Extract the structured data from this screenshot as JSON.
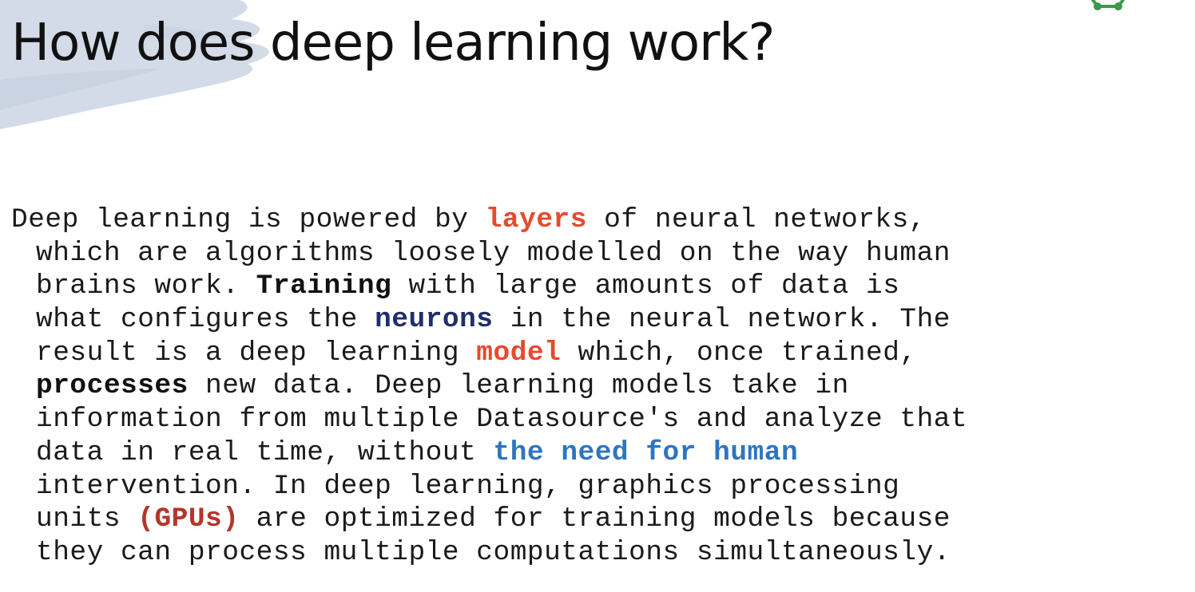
{
  "slide": {
    "title": "How does deep learning work?",
    "lines": [
      [
        {
          "text": "Deep learning is powered by "
        },
        {
          "text": "layers",
          "style": "orange"
        },
        {
          "text": " of neural networks,"
        }
      ],
      [
        {
          "text": "which are algorithms loosely modelled on the way human"
        }
      ],
      [
        {
          "text": "brains work. "
        },
        {
          "text": "Training",
          "style": "black"
        },
        {
          "text": " with large amounts of data is"
        }
      ],
      [
        {
          "text": "what configures the "
        },
        {
          "text": "neurons",
          "style": "navy"
        },
        {
          "text": " in the neural network. The"
        }
      ],
      [
        {
          "text": "result is a deep learning "
        },
        {
          "text": "model",
          "style": "orange"
        },
        {
          "text": " which, once trained,"
        }
      ],
      [
        {
          "text": "processes",
          "style": "black"
        },
        {
          "text": " new data. Deep learning models take in"
        }
      ],
      [
        {
          "text": "information from multiple Datasource's and analyze that"
        }
      ],
      [
        {
          "text": "data in real time, without "
        },
        {
          "text": "the need for human",
          "style": "blue"
        }
      ],
      [
        {
          "text": "intervention. In deep learning, graphics processing"
        }
      ],
      [
        {
          "text": "units "
        },
        {
          "text": "(GPUs)",
          "style": "red"
        },
        {
          "text": " are optimized for training models because"
        }
      ],
      [
        {
          "text": "they can process multiple computations simultaneously."
        }
      ]
    ]
  },
  "colors": {
    "orange": "#e64a2e",
    "black": "#111111",
    "navy": "#1f2f6b",
    "blue": "#2e75c0",
    "red": "#b5352a",
    "brush": "#d3dbe8",
    "logo": "#3a9a4a"
  },
  "icons": {
    "corner_logo": "green-network-logo-icon",
    "background": "blue-brush-stroke"
  }
}
